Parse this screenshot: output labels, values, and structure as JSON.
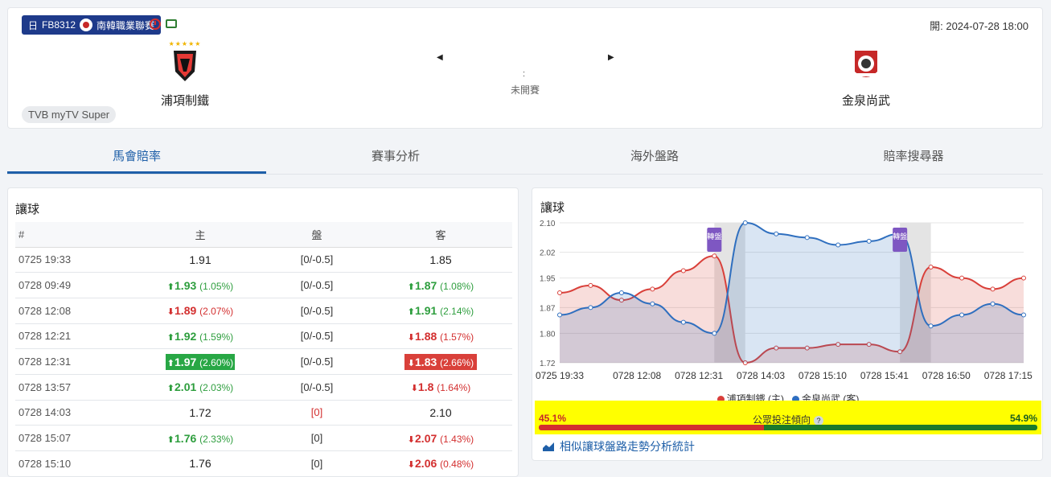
{
  "match": {
    "badge_prefix": "日",
    "badge_code": "FB8312",
    "league": "南韓職業聯賽",
    "kickoff_label": "開:",
    "kickoff_time": "2024-07-28 18:00",
    "home_team": "浦項制鐵",
    "home_stars": "★★★★★",
    "away_team": "金泉尚武",
    "left_arrow": "◀",
    "right_arrow": "▶",
    "score_separator": ":",
    "status": "未開賽",
    "tv_channel": "TVB myTV Super"
  },
  "tabs": [
    {
      "label": "馬會賠率",
      "active": true
    },
    {
      "label": "賽事分析",
      "active": false
    },
    {
      "label": "海外盤路",
      "active": false
    },
    {
      "label": "賠率搜尋器",
      "active": false
    }
  ],
  "odds_table": {
    "title": "讓球",
    "headers": [
      "#",
      "主",
      "盤",
      "客"
    ],
    "rows": [
      {
        "time": "0725 19:33",
        "home": "1.91",
        "home_dir": "",
        "home_pct": "",
        "line": "[0/-0.5]",
        "away": "1.85",
        "away_dir": "",
        "away_pct": ""
      },
      {
        "time": "0728 09:49",
        "home": "1.93",
        "home_dir": "up",
        "home_pct": "(1.05%)",
        "line": "[0/-0.5]",
        "away": "1.87",
        "away_dir": "up",
        "away_pct": "(1.08%)"
      },
      {
        "time": "0728 12:08",
        "home": "1.89",
        "home_dir": "down",
        "home_pct": "(2.07%)",
        "line": "[0/-0.5]",
        "away": "1.91",
        "away_dir": "up",
        "away_pct": "(2.14%)"
      },
      {
        "time": "0728 12:21",
        "home": "1.92",
        "home_dir": "up",
        "home_pct": "(1.59%)",
        "line": "[0/-0.5]",
        "away": "1.88",
        "away_dir": "down",
        "away_pct": "(1.57%)"
      },
      {
        "time": "0728 12:31",
        "home": "1.97",
        "home_dir": "up-hl",
        "home_pct": "(2.60%)",
        "line": "[0/-0.5]",
        "away": "1.83",
        "away_dir": "down-hl",
        "away_pct": "(2.66%)"
      },
      {
        "time": "0728 13:57",
        "home": "2.01",
        "home_dir": "up",
        "home_pct": "(2.03%)",
        "line": "[0/-0.5]",
        "away": "1.8",
        "away_dir": "down",
        "away_pct": "(1.64%)"
      },
      {
        "time": "0728 14:03",
        "home": "1.72",
        "home_dir": "",
        "home_pct": "",
        "line": "[0]",
        "line_red": true,
        "away": "2.10",
        "away_dir": "",
        "away_pct": ""
      },
      {
        "time": "0728 15:07",
        "home": "1.76",
        "home_dir": "up",
        "home_pct": "(2.33%)",
        "line": "[0]",
        "away": "2.07",
        "away_dir": "down",
        "away_pct": "(1.43%)"
      },
      {
        "time": "0728 15:10",
        "home": "1.76",
        "home_dir": "",
        "home_pct": "",
        "line": "[0]",
        "away": "2.06",
        "away_dir": "down",
        "away_pct": "(0.48%)"
      }
    ]
  },
  "chart": {
    "title": "讓球",
    "change_marker": "轉盤",
    "trend_label": "公眾投注傾向",
    "trend_help": "?",
    "trend_home_pct": "45.1%",
    "trend_away_pct": "54.9%",
    "trend_home_fraction": 0.451,
    "similar_link": "相似讓球盤路走勢分析統計",
    "colors": {
      "home": "#d9403a",
      "away": "#2f6fbf",
      "accent": "#1e5fa8"
    }
  },
  "chart_data": {
    "type": "line",
    "title": "讓球",
    "ylim": [
      1.72,
      2.1
    ],
    "yticks": [
      "2.10",
      "2.02",
      "1.95",
      "1.87",
      "1.80",
      "1.72"
    ],
    "xticks": [
      "0725 19:33",
      "0728 12:08",
      "0728 12:31",
      "0728 14:03",
      "0728 15:10",
      "0728 15:41",
      "0728 16:50",
      "0728 17:15"
    ],
    "series": [
      {
        "name": "浦項制鐵 (主)",
        "values": [
          1.91,
          1.93,
          1.89,
          1.92,
          1.97,
          2.01,
          1.72,
          1.76,
          1.76,
          1.77,
          1.77,
          1.75,
          1.98,
          1.95,
          1.92,
          1.95
        ]
      },
      {
        "name": "金泉尚武 (客)",
        "values": [
          1.85,
          1.87,
          1.91,
          1.88,
          1.83,
          1.8,
          2.1,
          2.07,
          2.06,
          2.04,
          2.05,
          2.07,
          1.82,
          1.85,
          1.88,
          1.85
        ]
      }
    ],
    "legend": "bottom",
    "grid": true
  }
}
